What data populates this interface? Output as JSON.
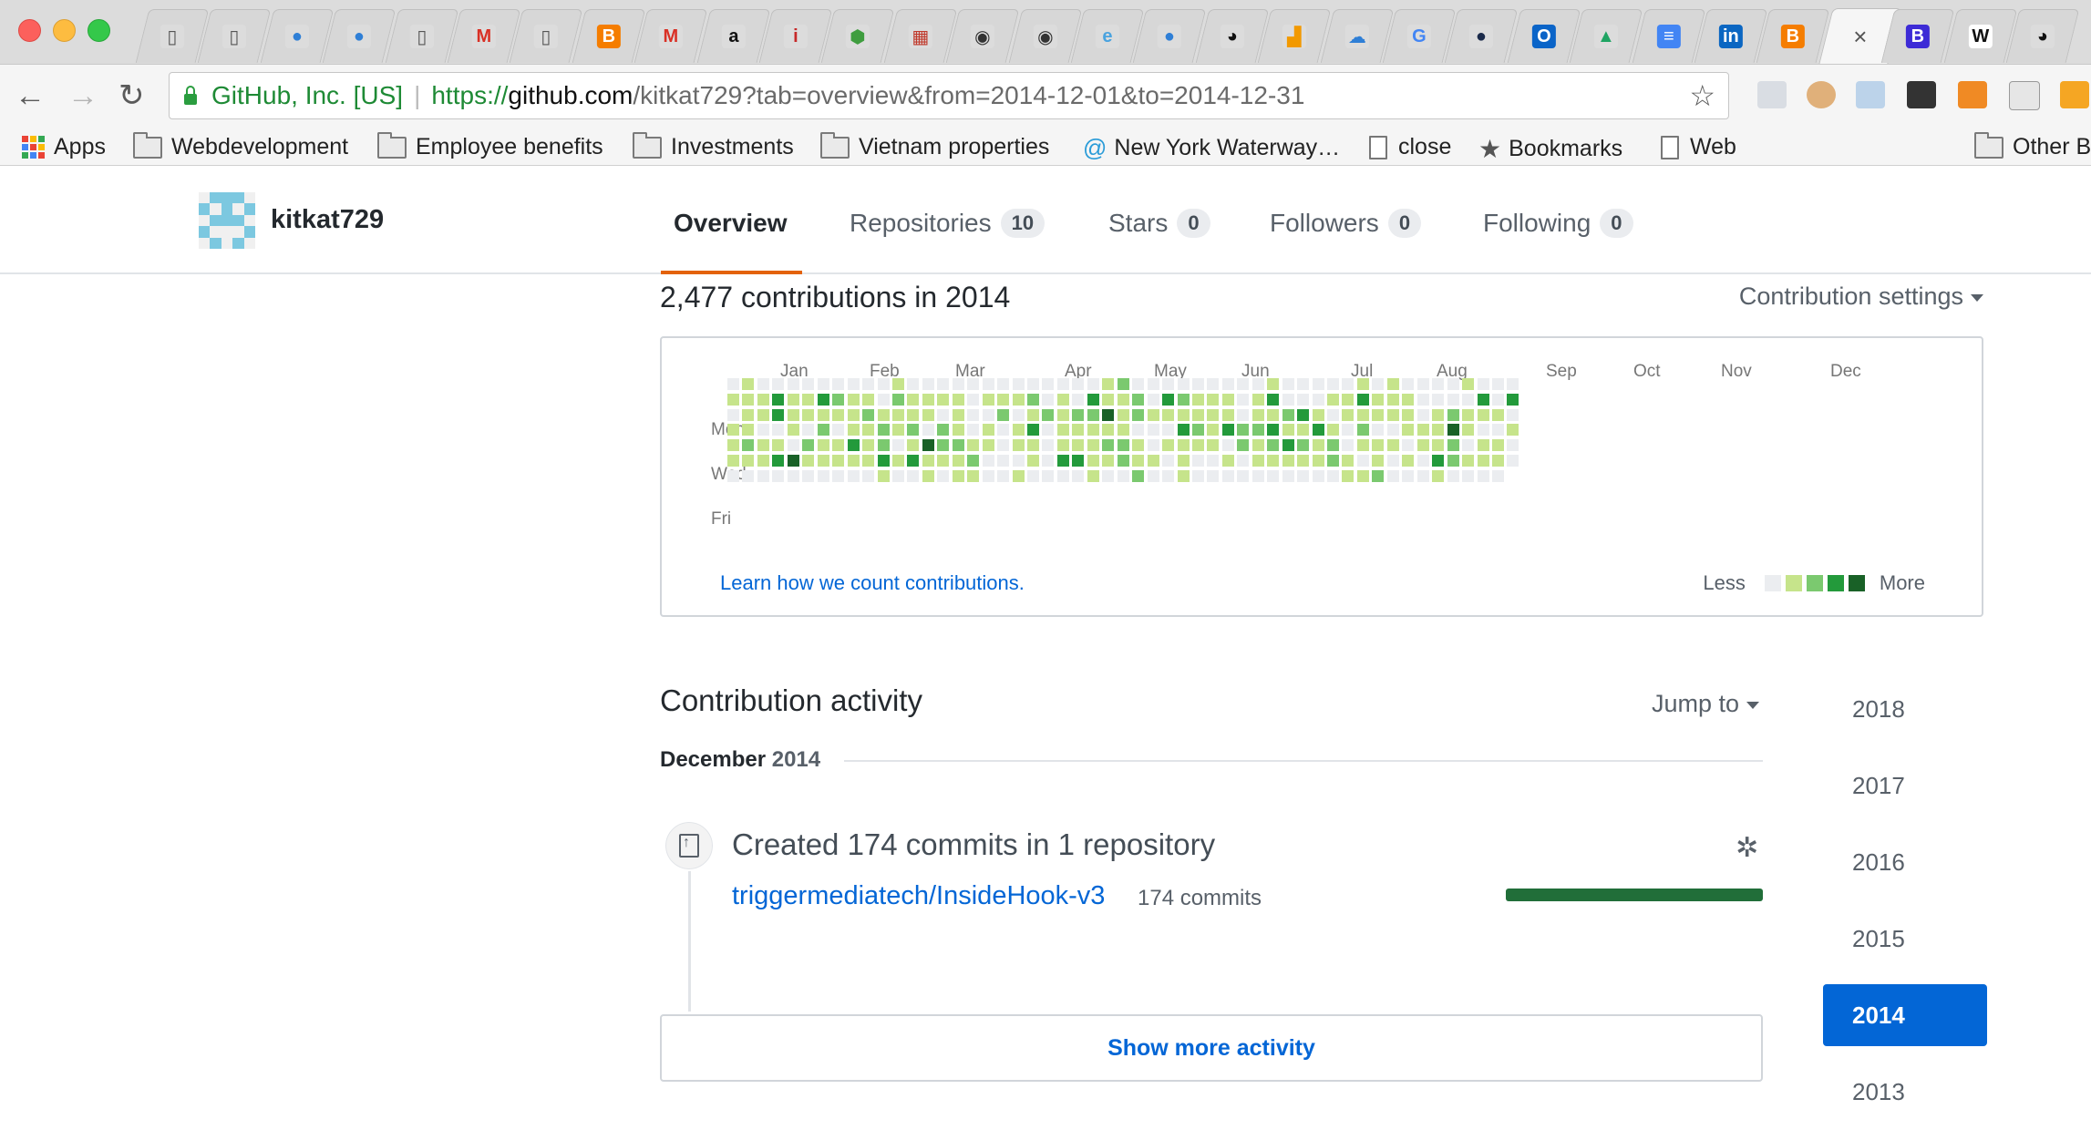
{
  "browser": {
    "tabs": [
      {
        "icon": "blank-page-icon",
        "glyph": "▯",
        "color": "#dcdcdc",
        "fg": "#555"
      },
      {
        "icon": "blank-page-icon",
        "glyph": "▯",
        "color": "#dcdcdc",
        "fg": "#555"
      },
      {
        "icon": "head-silhouette-icon",
        "glyph": "●",
        "color": "#dcdcdc",
        "fg": "#2f7fd6"
      },
      {
        "icon": "head-silhouette-icon",
        "glyph": "●",
        "color": "#dcdcdc",
        "fg": "#2f7fd6"
      },
      {
        "icon": "blank-page-icon",
        "glyph": "▯",
        "color": "#dcdcdc",
        "fg": "#555"
      },
      {
        "icon": "gmail-icon",
        "glyph": "M",
        "color": "#dcdcdc",
        "fg": "#d93025"
      },
      {
        "icon": "blank-page-icon",
        "glyph": "▯",
        "color": "#dcdcdc",
        "fg": "#555"
      },
      {
        "icon": "blogger-icon",
        "glyph": "B",
        "color": "#f57d00",
        "fg": "#ffffff"
      },
      {
        "icon": "gmail-icon",
        "glyph": "M",
        "color": "#dcdcdc",
        "fg": "#d93025"
      },
      {
        "icon": "amazon-icon",
        "glyph": "a",
        "color": "#dcdcdc",
        "fg": "#111"
      },
      {
        "icon": "info-italic-icon",
        "glyph": "i",
        "color": "#dcdcdc",
        "fg": "#c62828"
      },
      {
        "icon": "hexagon-icon",
        "glyph": "⬢",
        "color": "#dcdcdc",
        "fg": "#3f9d3f"
      },
      {
        "icon": "briefcase-icon",
        "glyph": "▦",
        "color": "#dcdcdc",
        "fg": "#c0392b"
      },
      {
        "icon": "seal-icon",
        "glyph": "◉",
        "color": "#dcdcdc",
        "fg": "#333"
      },
      {
        "icon": "seal-icon",
        "glyph": "◉",
        "color": "#dcdcdc",
        "fg": "#333"
      },
      {
        "icon": "loading-icon",
        "glyph": "e",
        "color": "#dcdcdc",
        "fg": "#4aa3df"
      },
      {
        "icon": "head-silhouette-icon",
        "glyph": "●",
        "color": "#dcdcdc",
        "fg": "#2f7fd6"
      },
      {
        "icon": "github-icon",
        "glyph": "◕",
        "color": "#dcdcdc",
        "fg": "#111"
      },
      {
        "icon": "analytics-icon",
        "glyph": "▟",
        "color": "#dcdcdc",
        "fg": "#f29900"
      },
      {
        "icon": "cloud-car-icon",
        "glyph": "☁",
        "color": "#dcdcdc",
        "fg": "#2f7fd6"
      },
      {
        "icon": "google-icon",
        "glyph": "G",
        "color": "#dcdcdc",
        "fg": "#4285f4"
      },
      {
        "icon": "lightbulb-icon",
        "glyph": "●",
        "color": "#dcdcdc",
        "fg": "#1a2a4a"
      },
      {
        "icon": "outlook-icon",
        "glyph": "O",
        "color": "#0a64c8",
        "fg": "#ffffff"
      },
      {
        "icon": "google-drive-icon",
        "glyph": "▲",
        "color": "#dcdcdc",
        "fg": "#1fa463"
      },
      {
        "icon": "google-docs-icon",
        "glyph": "≡",
        "color": "#4285f4",
        "fg": "#ffffff"
      },
      {
        "icon": "linkedin-icon",
        "glyph": "in",
        "color": "#0a66c2",
        "fg": "#ffffff"
      },
      {
        "icon": "blogger-icon",
        "glyph": "B",
        "color": "#f57d00",
        "fg": "#ffffff"
      },
      {
        "icon": "close-tab-icon",
        "glyph": "×",
        "color": "transparent",
        "fg": "#555"
      },
      {
        "icon": "bootstrap-icon",
        "glyph": "B",
        "color": "#3d2bd6",
        "fg": "#ffffff"
      },
      {
        "icon": "wikipedia-icon",
        "glyph": "W",
        "color": "#ffffff",
        "fg": "#111"
      },
      {
        "icon": "github-icon",
        "glyph": "◕",
        "color": "#dcdcdc",
        "fg": "#111"
      }
    ],
    "active_tab_index": 27,
    "org": "GitHub, Inc. [US]",
    "url_scheme": "https://",
    "url_host": "github.com",
    "url_path": "/kitkat729?tab=overview&from=2014-12-01&to=2014-12-31",
    "bookmarks": [
      {
        "label": "Apps",
        "icon": "apps-grid-icon"
      },
      {
        "label": "Webdevelopment",
        "icon": "folder-icon"
      },
      {
        "label": "Employee benefits",
        "icon": "folder-icon"
      },
      {
        "label": "Investments",
        "icon": "folder-icon"
      },
      {
        "label": "Vietnam properties",
        "icon": "folder-icon"
      },
      {
        "label": "New York Waterway…",
        "icon": "swirl-icon"
      },
      {
        "label": "close",
        "icon": "page-icon"
      },
      {
        "label": "Bookmarks",
        "icon": "star-icon"
      },
      {
        "label": "Web",
        "icon": "page-icon"
      },
      {
        "label": "Other B",
        "icon": "folder-icon"
      }
    ]
  },
  "profile": {
    "username": "kitkat729",
    "nav": [
      {
        "label": "Overview",
        "count": null,
        "selected": true
      },
      {
        "label": "Repositories",
        "count": "10"
      },
      {
        "label": "Stars",
        "count": "0"
      },
      {
        "label": "Followers",
        "count": "0"
      },
      {
        "label": "Following",
        "count": "0"
      }
    ]
  },
  "contributions": {
    "title": "2,477 contributions in 2014",
    "settings_label": "Contribution settings",
    "months": [
      "Jan",
      "Feb",
      "Mar",
      "Apr",
      "May",
      "Jun",
      "Jul",
      "Aug",
      "Sep",
      "Oct",
      "Nov",
      "Dec"
    ],
    "weekdays": [
      "Mon",
      "Wed",
      "Fri"
    ],
    "learn_link": "Learn how we count contributions.",
    "legend_less": "Less",
    "legend_more": "More",
    "colors": [
      "#ebedf0",
      "#c6e48b",
      "#7bc96f",
      "#239a3b",
      "#196127"
    ]
  },
  "activity": {
    "title": "Contribution activity",
    "jump_label": "Jump to",
    "month_label": "December",
    "month_year": "2014",
    "commit_summary": "Created 174 commits in 1 repository",
    "repo": "triggermediatech/InsideHook-v3",
    "repo_commits": "174 commits",
    "commit_share": 1.0,
    "show_more": "Show more activity"
  },
  "years": [
    "2018",
    "2017",
    "2016",
    "2015",
    "2014",
    "2013"
  ],
  "selected_year": "2014"
}
